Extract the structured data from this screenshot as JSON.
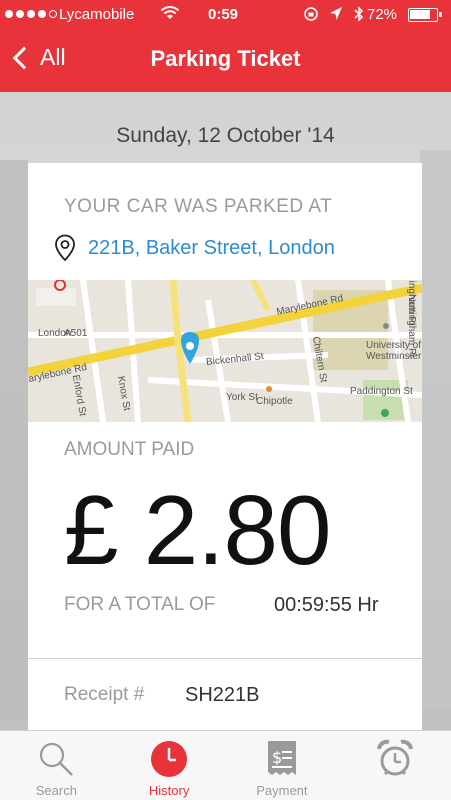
{
  "status_bar": {
    "carrier": "Lycamobile",
    "time": "0:59",
    "battery_percent": "72%",
    "battery_level": 0.72,
    "signal_bars": 4
  },
  "nav": {
    "back_label": "All",
    "title": "Parking Ticket"
  },
  "ticket": {
    "date": "Sunday, 12 October '14",
    "parked_label": "YOUR CAR WAS PARKED AT",
    "address": "221B, Baker Street, London",
    "amount_label": "AMOUNT PAID",
    "amount": "£ 2.80",
    "total_label": "FOR A TOTAL OF",
    "duration": "00:59:55 Hr",
    "receipt_label": "Receipt #",
    "receipt_number": "SH221B"
  },
  "map": {
    "labels": {
      "marylebone_rd": "Marylebone Rd",
      "marylebone_rd_left": "arylebone Rd",
      "london": "London",
      "bickenhall": "Bickenhall St",
      "york": "York St",
      "chipotle": "Chipotle",
      "chiltern": "Chiltern St",
      "paddington": "Paddington St",
      "university": "University of",
      "westminster": "Westminster",
      "nottingham": "Nottingham Pl",
      "bingham": "Bingham Pl",
      "enford": "Enford St",
      "knox": "Knox St",
      "a501": "A501"
    }
  },
  "tabs": [
    {
      "label": "Search",
      "icon": "search-icon"
    },
    {
      "label": "History",
      "icon": "clock-icon"
    },
    {
      "label": "Payment",
      "icon": "receipt-icon"
    },
    {
      "label": "",
      "icon": "alarm-icon"
    }
  ],
  "colors": {
    "accent": "#e8333b",
    "link": "#2b8bd3"
  }
}
